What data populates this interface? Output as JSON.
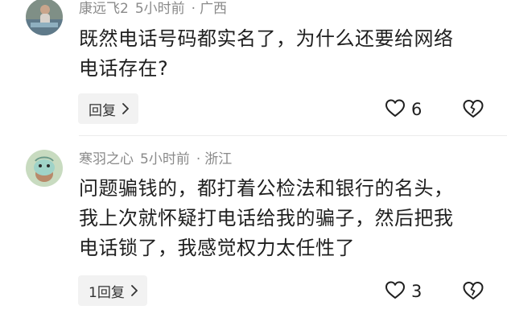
{
  "comments": [
    {
      "username": "康远飞2",
      "time": "5小时前",
      "separator": "·",
      "location": "广西",
      "lines": [
        "既然电话号码都实名了，为什么还要给网络",
        "电话存在?"
      ],
      "reply_label": "回复",
      "like_count": "6"
    },
    {
      "username": "寒羽之心",
      "time": "5小时前",
      "separator": "·",
      "location": "浙江",
      "lines": [
        "问题骗钱的，都打着公检法和银行的名头，",
        "我上次就怀疑打电话给我的骗子，然后把我",
        "电话锁了，我感觉权力太任性了"
      ],
      "reply_label": "1回复",
      "like_count": "3"
    }
  ],
  "icons": {
    "like": "heart-outline-icon",
    "dislike": "broken-heart-icon",
    "reply_chevron": "chevron-right-icon"
  },
  "colors": {
    "meta": "#8a8a8a",
    "text": "#1f1f1f",
    "reply_bg": "#f2f2f2"
  }
}
